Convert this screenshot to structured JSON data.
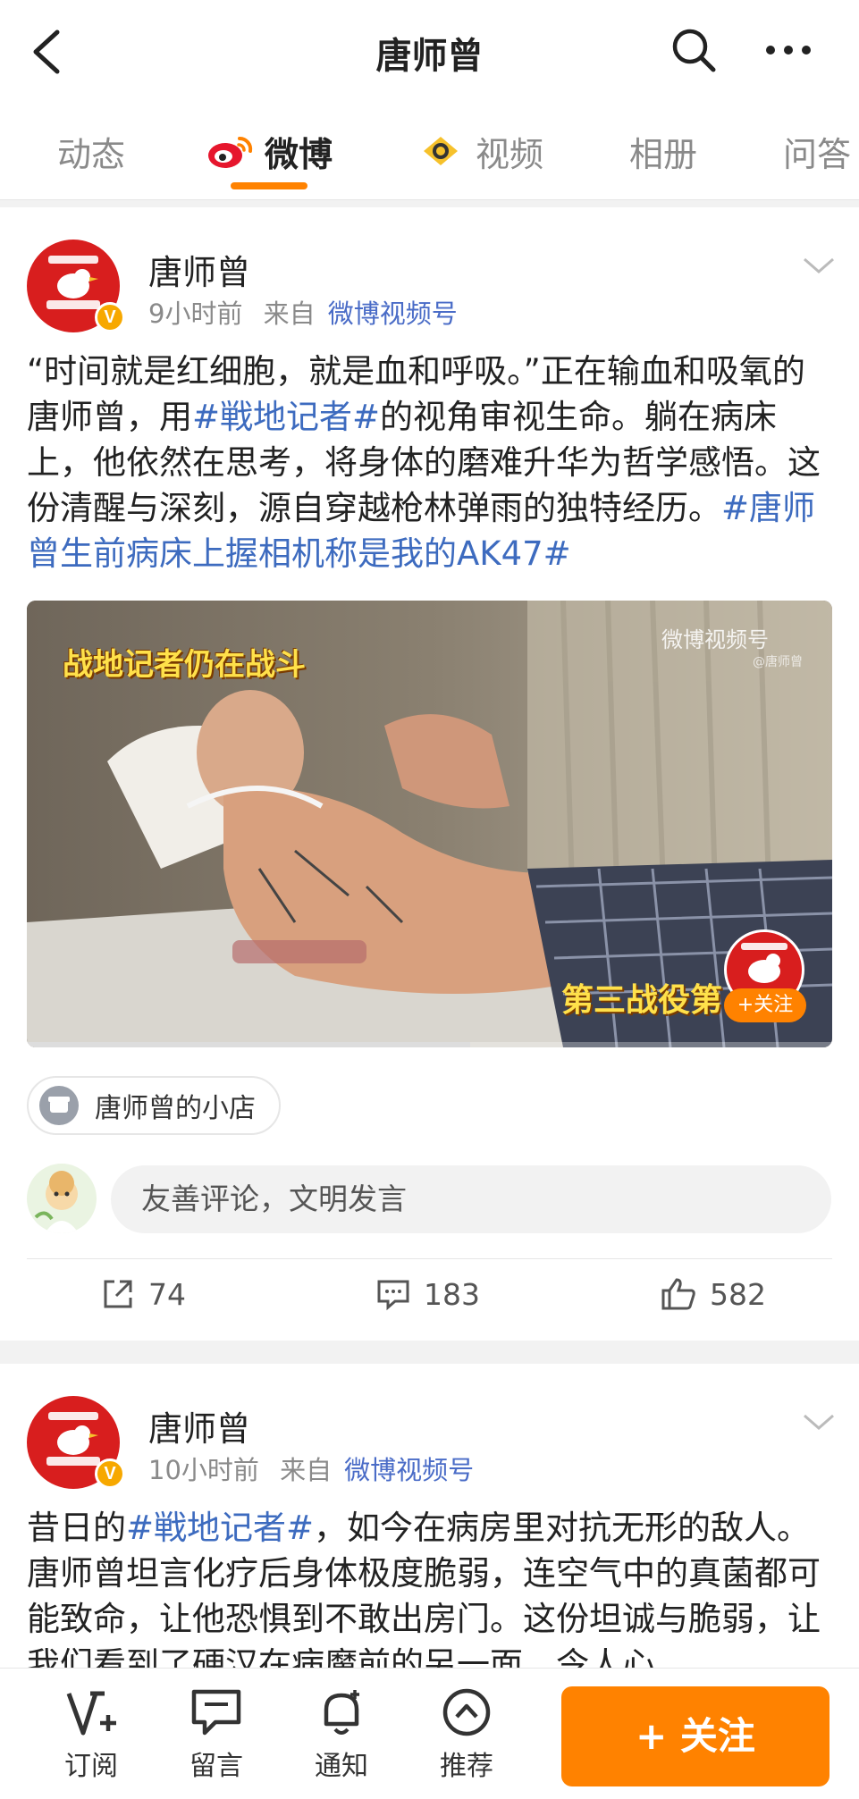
{
  "header": {
    "title": "唐师曾"
  },
  "tabs": [
    {
      "label": "动态"
    },
    {
      "label": "微博"
    },
    {
      "label": "视频"
    },
    {
      "label": "相册"
    },
    {
      "label": "问答"
    }
  ],
  "posts": [
    {
      "author": "唐师曾",
      "time": "9小时前",
      "from_prefix": "来自",
      "source": "微博视频号",
      "text_parts": [
        {
          "t": "“时间就是红细胞，就是血和呼吸。”正在输血和吸氧的唐师曾，用",
          "tag": false
        },
        {
          "t": "#戦地记者#",
          "tag": true
        },
        {
          "t": "的视角审视生命。躺在病床上，他依然在思考，将身体的磨难升华为哲学感悟。这份清醒与深刻，源自穿越枪林弹雨的独特经历。",
          "tag": false
        },
        {
          "t": "#唐师曾生前病床上握相机称是我的AK47#",
          "tag": true
        }
      ],
      "video": {
        "caption_top": "战地记者仍在战斗",
        "watermark": "微博视频号",
        "watermark_sub": "@唐师曾",
        "caption_bottom": "第三战役第",
        "follow": "+关注",
        "progress": 0.55
      },
      "shop": "唐师曾的小店",
      "comment_placeholder": "友善评论，文明发言",
      "reposts": "74",
      "comments": "183",
      "likes": "582"
    },
    {
      "author": "唐师曾",
      "time": "10小时前",
      "from_prefix": "来自",
      "source": "微博视频号",
      "text_parts": [
        {
          "t": "昔日的",
          "tag": false
        },
        {
          "t": "#戦地记者#",
          "tag": true
        },
        {
          "t": "，如今在病房里对抗无形的敌人。唐师曾坦言化疗后身体极度脆弱，连空气中的真菌都可能致命，让他恐惧到不敢出房门。这份坦诚与脆弱，让我们看到了硬汉在病魔前的另一面，令人心",
          "tag": false
        }
      ]
    }
  ],
  "bottom_bar": {
    "subscribe": "订阅",
    "message": "留言",
    "notify": "通知",
    "recommend": "推荐",
    "follow": "+ 关注"
  },
  "colors": {
    "accent": "#ff8200",
    "link": "#3d6bbf",
    "avatar_red": "#d81e1e"
  }
}
